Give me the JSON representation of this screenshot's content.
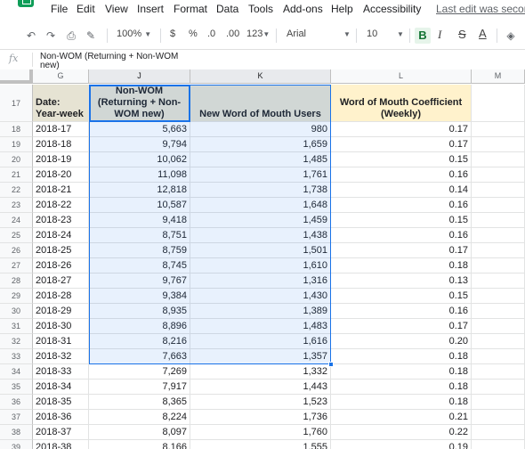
{
  "menu": [
    "File",
    "Edit",
    "View",
    "Insert",
    "Format",
    "Data",
    "Tools",
    "Add-ons",
    "Help",
    "Accessibility"
  ],
  "last_edit": "Last edit was seconds ago",
  "toolbar": {
    "zoom": "100%",
    "currency": "$",
    "percent": "%",
    "dec_less": ".0",
    "dec_more": ".00",
    "more_formats": "123",
    "font": "Arial",
    "font_size": "10",
    "bold": "B",
    "italic": "I",
    "strike": "S",
    "text_color": "A"
  },
  "formula_bar": {
    "fx": "fx",
    "content": "Non-WOM (Returning + Non-WOM new)"
  },
  "columns": [
    "G",
    "J",
    "K",
    "L",
    "M"
  ],
  "header_row": {
    "row": "17",
    "date": "Date: Year-week",
    "non_wom": "Non-WOM (Returning + Non-WOM new)",
    "new_wom": "New Word of Mouth Users",
    "coef": "Word of Mouth Coefficient (Weekly)"
  },
  "rows": [
    {
      "row": "18",
      "date": "2018-17",
      "non_wom": "5,663",
      "new_wom": "980",
      "coef": "0.17"
    },
    {
      "row": "19",
      "date": "2018-18",
      "non_wom": "9,794",
      "new_wom": "1,659",
      "coef": "0.17"
    },
    {
      "row": "20",
      "date": "2018-19",
      "non_wom": "10,062",
      "new_wom": "1,485",
      "coef": "0.15"
    },
    {
      "row": "21",
      "date": "2018-20",
      "non_wom": "11,098",
      "new_wom": "1,761",
      "coef": "0.16"
    },
    {
      "row": "22",
      "date": "2018-21",
      "non_wom": "12,818",
      "new_wom": "1,738",
      "coef": "0.14"
    },
    {
      "row": "23",
      "date": "2018-22",
      "non_wom": "10,587",
      "new_wom": "1,648",
      "coef": "0.16"
    },
    {
      "row": "24",
      "date": "2018-23",
      "non_wom": "9,418",
      "new_wom": "1,459",
      "coef": "0.15"
    },
    {
      "row": "25",
      "date": "2018-24",
      "non_wom": "8,751",
      "new_wom": "1,438",
      "coef": "0.16"
    },
    {
      "row": "26",
      "date": "2018-25",
      "non_wom": "8,759",
      "new_wom": "1,501",
      "coef": "0.17"
    },
    {
      "row": "27",
      "date": "2018-26",
      "non_wom": "8,745",
      "new_wom": "1,610",
      "coef": "0.18"
    },
    {
      "row": "28",
      "date": "2018-27",
      "non_wom": "9,767",
      "new_wom": "1,316",
      "coef": "0.13"
    },
    {
      "row": "29",
      "date": "2018-28",
      "non_wom": "9,384",
      "new_wom": "1,430",
      "coef": "0.15"
    },
    {
      "row": "30",
      "date": "2018-29",
      "non_wom": "8,935",
      "new_wom": "1,389",
      "coef": "0.16"
    },
    {
      "row": "31",
      "date": "2018-30",
      "non_wom": "8,896",
      "new_wom": "1,483",
      "coef": "0.17"
    },
    {
      "row": "32",
      "date": "2018-31",
      "non_wom": "8,216",
      "new_wom": "1,616",
      "coef": "0.20"
    },
    {
      "row": "33",
      "date": "2018-32",
      "non_wom": "7,663",
      "new_wom": "1,357",
      "coef": "0.18"
    },
    {
      "row": "34",
      "date": "2018-33",
      "non_wom": "7,269",
      "new_wom": "1,332",
      "coef": "0.18"
    },
    {
      "row": "35",
      "date": "2018-34",
      "non_wom": "7,917",
      "new_wom": "1,443",
      "coef": "0.18"
    },
    {
      "row": "36",
      "date": "2018-35",
      "non_wom": "8,365",
      "new_wom": "1,523",
      "coef": "0.18"
    },
    {
      "row": "37",
      "date": "2018-36",
      "non_wom": "8,224",
      "new_wom": "1,736",
      "coef": "0.21"
    },
    {
      "row": "38",
      "date": "2018-37",
      "non_wom": "8,097",
      "new_wom": "1,760",
      "coef": "0.22"
    },
    {
      "row": "39",
      "date": "2018-38",
      "non_wom": "8,166",
      "new_wom": "1,555",
      "coef": "0.19"
    }
  ],
  "colors": {
    "header_bg": "#e6e3d3",
    "header_coef_bg": "#fff2cc",
    "selection": "#1a73e8",
    "sheets_green": "#0f9d58"
  }
}
